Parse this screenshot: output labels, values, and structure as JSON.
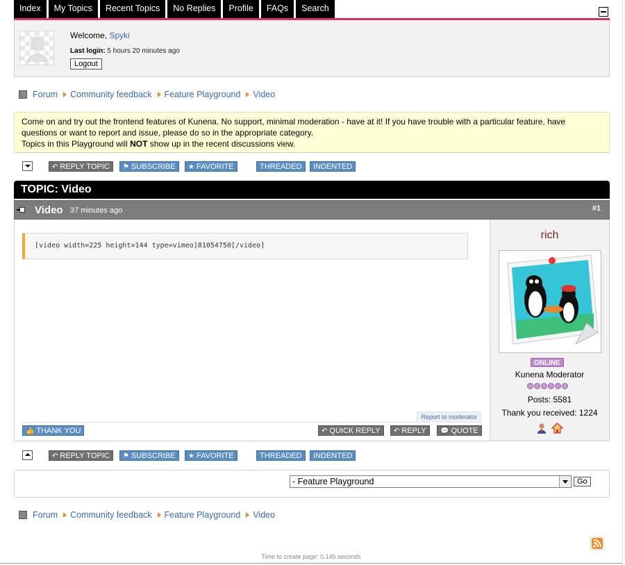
{
  "nav": {
    "tabs": [
      "Index",
      "My Topics",
      "Recent Topics",
      "No Replies",
      "Profile",
      "FAQs",
      "Search"
    ]
  },
  "profile": {
    "welcome_prefix": "Welcome,",
    "username": "Spyki",
    "last_login_label": "Last login:",
    "last_login_value": "5 hours 20 minutes ago",
    "logout_label": "Logout"
  },
  "breadcrumbs": [
    "Forum",
    "Community feedback",
    "Feature Playground",
    "Video"
  ],
  "announcement": {
    "line1": "Come on and try out the frontend features of Kunena. No support, minimal moderation - have at it! If you have trouble with a particular feature, have",
    "line2": "questions or want to report and issue, please do so in the appropriate category.",
    "line3_pre": "Topics in this Playground will ",
    "line3_bold": "NOT",
    "line3_post": " show up in the recent discussions view."
  },
  "actions": {
    "reply_topic": "REPLY TOPIC",
    "subscribe": "SUBSCRIBE",
    "favorite": "FAVORITE",
    "threaded": "THREADED",
    "indented": "INDENTED"
  },
  "topic": {
    "title": "TOPIC: Video"
  },
  "message": {
    "subject": "Video",
    "time_ago": "37 minutes ago",
    "number": "#1",
    "code": "[video width=225 height=144 type=vimeo]81054750[/video]",
    "report_label": "Report to moderator",
    "thank_you": "THANK YOU",
    "quick_reply": "QUICK REPLY",
    "reply": "REPLY",
    "quote": "QUOTE"
  },
  "author": {
    "name": "rich",
    "status": "ONLINE",
    "rank": "Kunena Moderator",
    "posts": "Posts: 5581",
    "thanks": "Thank you received: 1224"
  },
  "jump": {
    "selected": "- Feature Playground",
    "go_label": "Go"
  },
  "footer": {
    "time": "Time to create page: 0.145 seconds"
  },
  "colors": {
    "nav_bg": "#000000",
    "nav_accent": "#d6305f",
    "button_blue": "#5a8dc3",
    "button_grey": "#707070",
    "announce_bg": "#ffffd6",
    "online": "#c08acb",
    "author_name": "#8b1a1a"
  }
}
